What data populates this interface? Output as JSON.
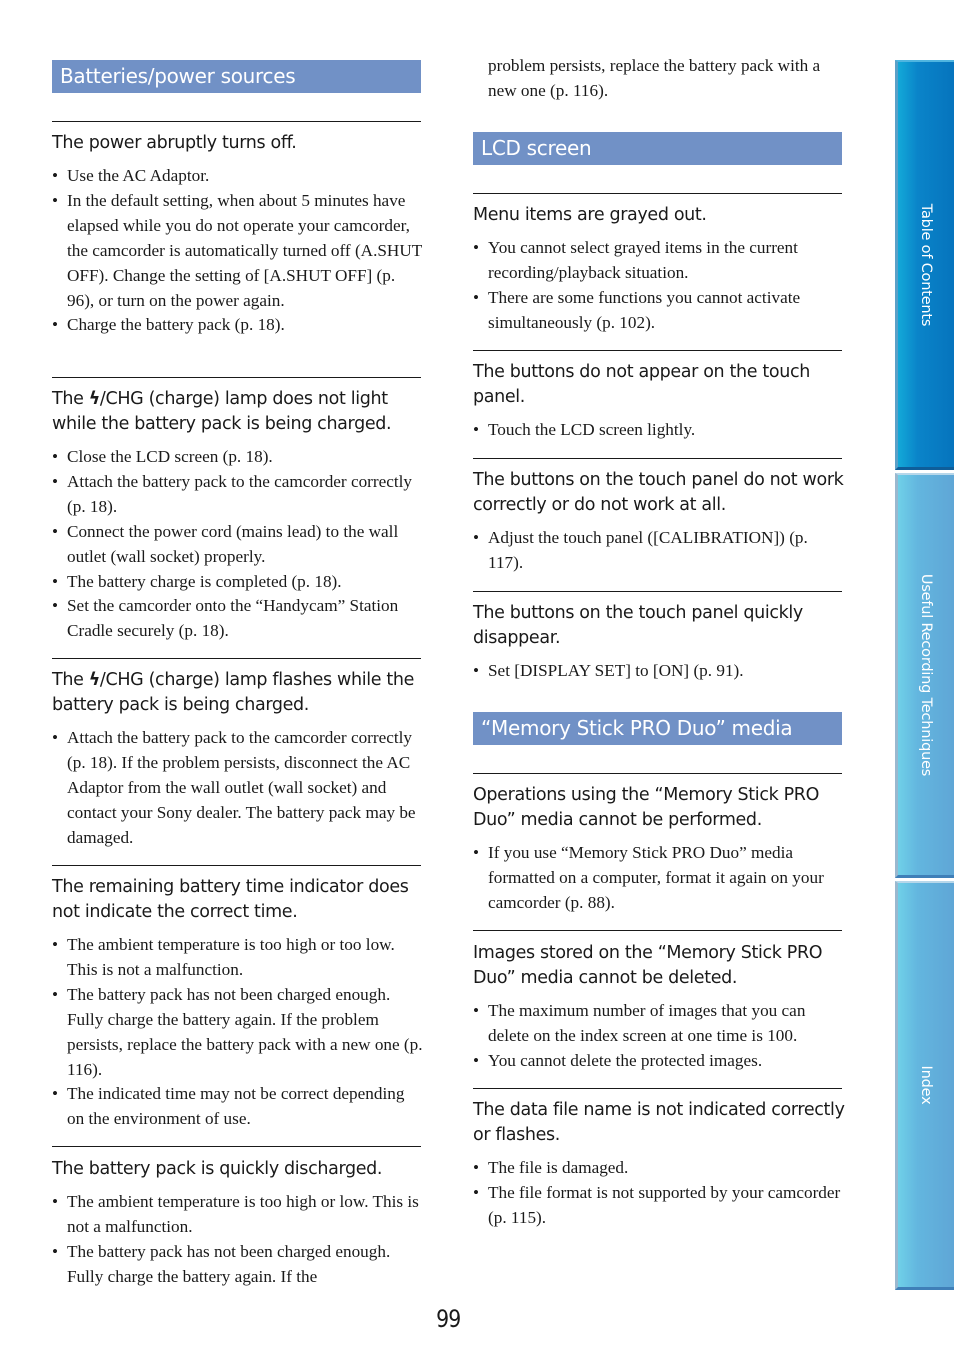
{
  "page_number": "99",
  "side_tabs": [
    {
      "label": "Table of Contents"
    },
    {
      "label": "Useful Recording Techniques"
    },
    {
      "label": "Index"
    }
  ],
  "bullet_glyph": "•",
  "bolt_glyph": "ϟ",
  "sections": {
    "batteries": {
      "title": "Batteries/power sources",
      "items": [
        {
          "heading": "The power abruptly turns off.",
          "bullets": [
            "Use the AC Adaptor.",
            "In the default setting, when about 5 minutes have elapsed while you do not operate your camcorder, the camcorder is automatically turned off (A.SHUT OFF). Change the setting of [A.SHUT OFF] (p. 96), or turn on the power again.",
            "Charge the battery pack (p. 18)."
          ]
        },
        {
          "heading_pre": "The ",
          "heading_post": "/CHG (charge) lamp does not light while the battery pack is being charged.",
          "bullets": [
            "Close the LCD screen (p. 18).",
            "Attach the battery pack to the camcorder correctly (p. 18).",
            "Connect the power cord (mains lead) to the wall outlet (wall socket) properly.",
            "The battery charge is completed (p. 18).",
            "Set the camcorder onto the “Handycam” Station Cradle securely (p. 18)."
          ]
        },
        {
          "heading_pre": "The ",
          "heading_post": "/CHG (charge) lamp flashes while the battery pack is being charged.",
          "bullets": [
            "Attach the battery pack to the camcorder correctly (p. 18). If the problem persists, disconnect the AC Adaptor from the wall outlet (wall socket) and contact your Sony dealer. The battery pack may be damaged."
          ]
        },
        {
          "heading": "The remaining battery time indicator does not indicate the correct time.",
          "bullets": [
            "The ambient temperature is too high or too low. This is not a malfunction.",
            "The battery pack has not been charged enough. Fully charge the battery again. If the problem persists, replace the battery pack with a new one (p. 116).",
            "The indicated time may not be correct depending on the environment of use."
          ]
        },
        {
          "heading": "The battery pack is quickly discharged.",
          "bullets": [
            "The ambient temperature is too high or low. This is not a malfunction.",
            "The battery pack has not been charged enough. Fully charge the battery again. If the"
          ],
          "continuation": "problem persists, replace the battery pack with a new one (p. 116)."
        }
      ]
    },
    "lcd": {
      "title": "LCD screen",
      "items": [
        {
          "heading": "Menu items are grayed out.",
          "bullets": [
            "You cannot select grayed items in the current recording/playback situation.",
            "There are some functions you cannot activate simultaneously (p. 102)."
          ]
        },
        {
          "heading": "The buttons do not appear on the touch panel.",
          "bullets": [
            "Touch the LCD screen lightly."
          ]
        },
        {
          "heading": "The buttons on the touch panel do not work correctly or do not work at all.",
          "bullets": [
            "Adjust the touch panel ([CALIBRATION]) (p. 117)."
          ]
        },
        {
          "heading": "The buttons on the touch panel quickly disappear.",
          "bullets": [
            "Set [DISPLAY SET] to [ON] (p. 91)."
          ]
        }
      ]
    },
    "memory_stick": {
      "title": "“Memory Stick PRO Duo” media",
      "items": [
        {
          "heading": "Operations using the “Memory Stick PRO Duo” media cannot be performed.",
          "bullets": [
            "If you use “Memory Stick PRO Duo” media formatted on a computer, format it again on your camcorder (p. 88)."
          ]
        },
        {
          "heading": "Images stored on the “Memory Stick PRO Duo” media cannot be deleted.",
          "bullets": [
            "The maximum number of images that you can delete on the index screen at one time is 100.",
            "You cannot delete the protected images."
          ]
        },
        {
          "heading": "The data file name is not indicated correctly or flashes.",
          "bullets": [
            "The file is damaged.",
            "The file format is not supported by your camcorder (p. 115)."
          ]
        }
      ]
    }
  },
  "colors": {
    "section_header_bg": "#7191c6",
    "tab_active": "#0674bd",
    "tab_inactive": "#5fa6d6"
  }
}
